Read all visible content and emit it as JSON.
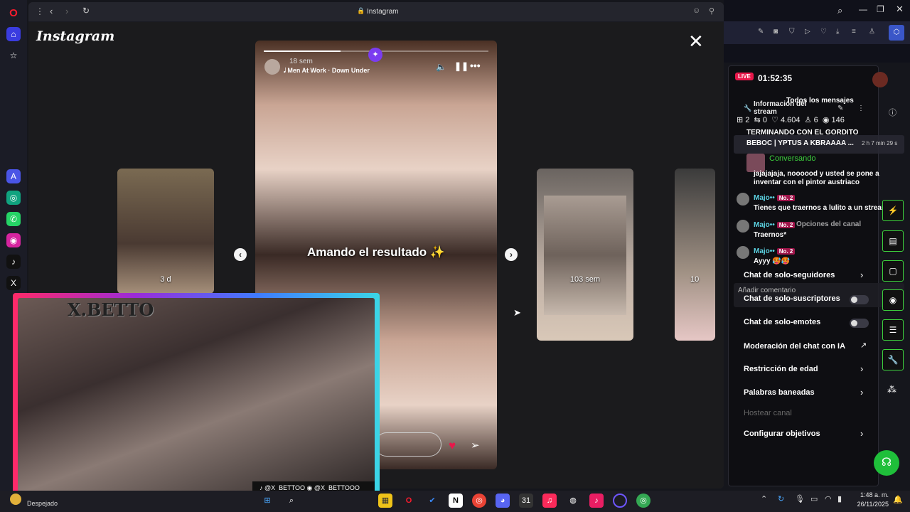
{
  "browser": {
    "url_text": "Instagram",
    "brand": "Instagram"
  },
  "story": {
    "time_ago": "18 sem",
    "music": "Men At Work · Down Under",
    "caption": "Amando el resultado ✨",
    "left_label": "3 d",
    "right_label": "103 sem",
    "far_right_label": "10"
  },
  "stream": {
    "live_badge": "LIVE",
    "elapsed": "01:52:35",
    "info_title": "Información del stream",
    "all_messages": "Todos los mensajes",
    "stats": {
      "gifts": "2",
      "shares": "0",
      "likes": "4.604",
      "viewers_small": "6",
      "views": "146"
    },
    "pinned_title": "TERMINANDO CON EL GORDITO",
    "pinned_sub": "BEBOC | YPTUS A KBRAAAA ...",
    "pinned_time": "2 h 7 min 29 s",
    "conversando": "Conversando",
    "chat": [
      {
        "user": "",
        "badge": "",
        "text": "jajajajaja, noooood y usted se pone a inventar con el pintor austriaco"
      },
      {
        "user": "Majo••",
        "badge": "No. 2",
        "text": "Tienes que traernos a lulito a un stream"
      },
      {
        "user": "Majo••",
        "badge": "No. 2",
        "text": "Traernos*"
      },
      {
        "user": "Majo••",
        "badge": "No. 2",
        "text": "Ayyy 🥵🥵"
      }
    ],
    "mod_overlay": "Opciones del canal",
    "add_comment": "Añadir comentario",
    "menu": [
      {
        "label": "Chat de solo-seguidores",
        "control": "chevron"
      },
      {
        "label": "Chat de solo-suscriptores",
        "control": "toggle"
      },
      {
        "label": "Chat de solo-emotes",
        "control": "toggle"
      },
      {
        "label": "Moderación del chat con IA",
        "control": "external"
      },
      {
        "label": "Restricción de edad",
        "control": "chevron"
      },
      {
        "label": "Palabras baneadas",
        "control": "chevron"
      },
      {
        "label": "Hostear canal",
        "control": "disabled"
      },
      {
        "label": "Configurar objetivos",
        "control": "chevron"
      }
    ]
  },
  "webcam": {
    "name_overlay": "X.BETTO",
    "tiktok": "@X_BETTOO",
    "instagram": "@X_BETTOOO"
  },
  "taskbar": {
    "weather": "Despejado",
    "time": "1:48 a. m.",
    "date": "26/11/2025"
  },
  "colors": {
    "live_red": "#e8184b",
    "accent_green": "#3dd13d",
    "story_purple": "#7b3cf0",
    "heart_red": "#e8184b"
  }
}
